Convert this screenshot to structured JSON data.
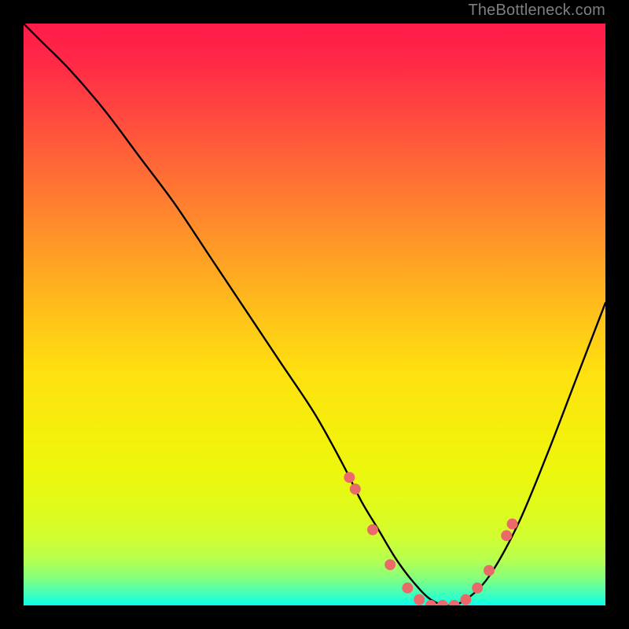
{
  "attribution": "TheBottleneck.com",
  "chart_data": {
    "type": "line",
    "title": "",
    "xlabel": "",
    "ylabel": "",
    "xlim": [
      0,
      100
    ],
    "ylim": [
      0,
      100
    ],
    "series": [
      {
        "name": "bottleneck-curve",
        "x": [
          0,
          3,
          8,
          14,
          20,
          26,
          32,
          38,
          44,
          50,
          55,
          58,
          61,
          64,
          67,
          70,
          73,
          76,
          80,
          85,
          90,
          95,
          100
        ],
        "y": [
          100,
          97,
          92,
          85,
          77,
          69,
          60,
          51,
          42,
          33,
          24,
          18,
          13,
          8,
          4,
          1,
          0,
          1,
          5,
          14,
          26,
          39,
          52
        ]
      }
    ],
    "markers": {
      "name": "highlight-points",
      "color": "#ea6a6a",
      "x": [
        56,
        57,
        60,
        63,
        66,
        68,
        70,
        72,
        74,
        76,
        78,
        80,
        83,
        84
      ],
      "y": [
        22,
        20,
        13,
        7,
        3,
        1,
        0,
        0,
        0,
        1,
        3,
        6,
        12,
        14
      ]
    }
  }
}
